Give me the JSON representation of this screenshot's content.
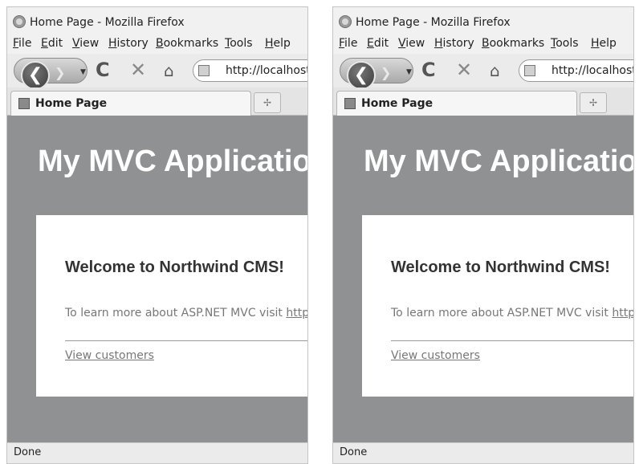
{
  "windows": [
    {
      "title": "Home Page - Mozilla Firefox",
      "menu": [
        "File",
        "Edit",
        "View",
        "History",
        "Bookmarks",
        "Tools",
        "Help"
      ],
      "url": "http://localhost:",
      "tab_label": "Home Page",
      "app_title": "My MVC Application",
      "welcome": "Welcome to Northwind CMS!",
      "learn_text": "To learn more about ASP.NET MVC visit ",
      "learn_link": "http://asp.net/mvc",
      "customers_link": "View customers",
      "status": "Done"
    },
    {
      "title": "Home Page - Mozilla Firefox",
      "menu": [
        "File",
        "Edit",
        "View",
        "History",
        "Bookmarks",
        "Tools",
        "Help"
      ],
      "url": "http://localhost:",
      "tab_label": "Home Page",
      "app_title": "My MVC Application",
      "welcome": "Welcome to Northwind CMS!",
      "learn_text": "To learn more about ASP.NET MVC visit ",
      "learn_link": "http://asp.net/mvc",
      "customers_link": "View customers",
      "status": "Done"
    }
  ],
  "icons": {
    "app": "firefox-icon",
    "back": "back-arrow-icon",
    "forward": "forward-arrow-icon",
    "dropdown": "chevron-down-icon",
    "reload": "reload-icon",
    "stop": "stop-icon",
    "home": "home-icon",
    "site": "site-identity-icon",
    "tab": "tab-favicon",
    "new_tab": "new-tab-icon"
  },
  "glyphs": {
    "back": "❮",
    "forward": "❯",
    "dropdown": "▼",
    "reload": "C",
    "stop": "✕",
    "home": "⌂",
    "new_tab": "✢"
  },
  "colors": {
    "content_bg": "#8f9193",
    "panel_bg": "#ffffff",
    "title_text": "#ffffff"
  }
}
